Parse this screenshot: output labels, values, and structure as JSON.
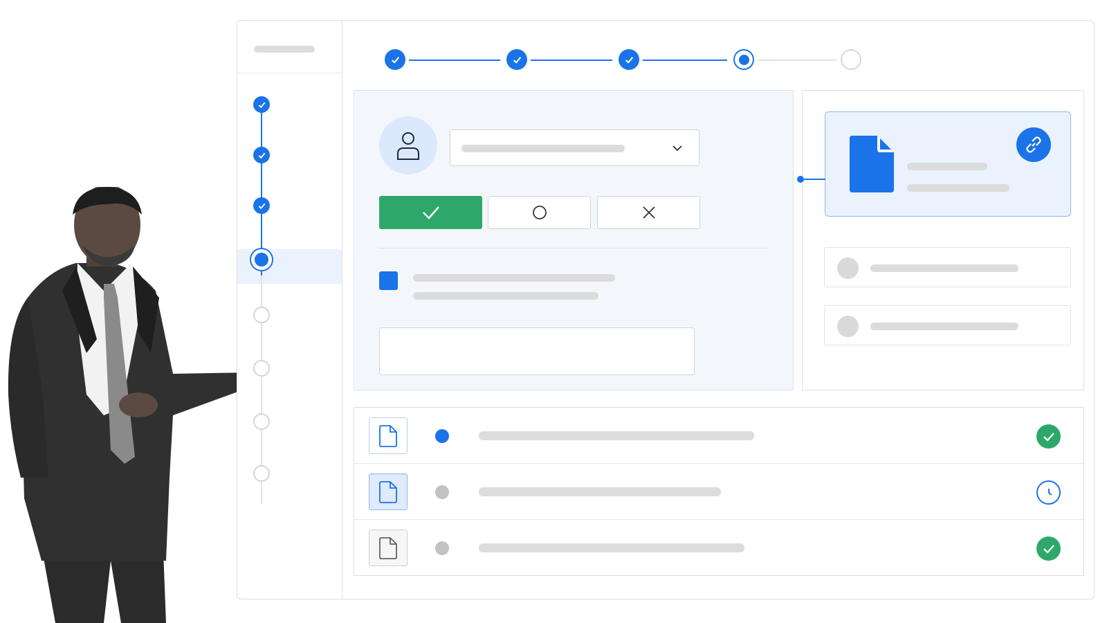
{
  "sidebar": {
    "steps": [
      {
        "state": "done"
      },
      {
        "state": "done"
      },
      {
        "state": "done"
      },
      {
        "state": "current"
      },
      {
        "state": "todo"
      },
      {
        "state": "todo"
      },
      {
        "state": "todo"
      },
      {
        "state": "todo"
      }
    ]
  },
  "stepper": {
    "steps": [
      {
        "state": "done"
      },
      {
        "state": "done"
      },
      {
        "state": "done"
      },
      {
        "state": "current"
      },
      {
        "state": "todo"
      }
    ]
  },
  "form": {
    "avatar_icon": "user-icon",
    "dropdown_icon": "chevron-down-icon",
    "actions": [
      {
        "name": "approve",
        "icon": "check-icon",
        "selected": true
      },
      {
        "name": "neutral",
        "icon": "circle-icon",
        "selected": false
      },
      {
        "name": "reject",
        "icon": "close-icon",
        "selected": false
      }
    ],
    "checkbox_checked": true
  },
  "linked_document": {
    "icon": "document-icon",
    "action_icon": "link-icon"
  },
  "files": [
    {
      "icon": "file-icon",
      "active": true,
      "status": "complete"
    },
    {
      "icon": "file-icon",
      "active": false,
      "status": "pending"
    },
    {
      "icon": "file-icon",
      "active": false,
      "status": "complete"
    }
  ],
  "colors": {
    "accent": "#1a73e8",
    "success": "#2ea86a",
    "placeholder": "#dcdcdc"
  }
}
